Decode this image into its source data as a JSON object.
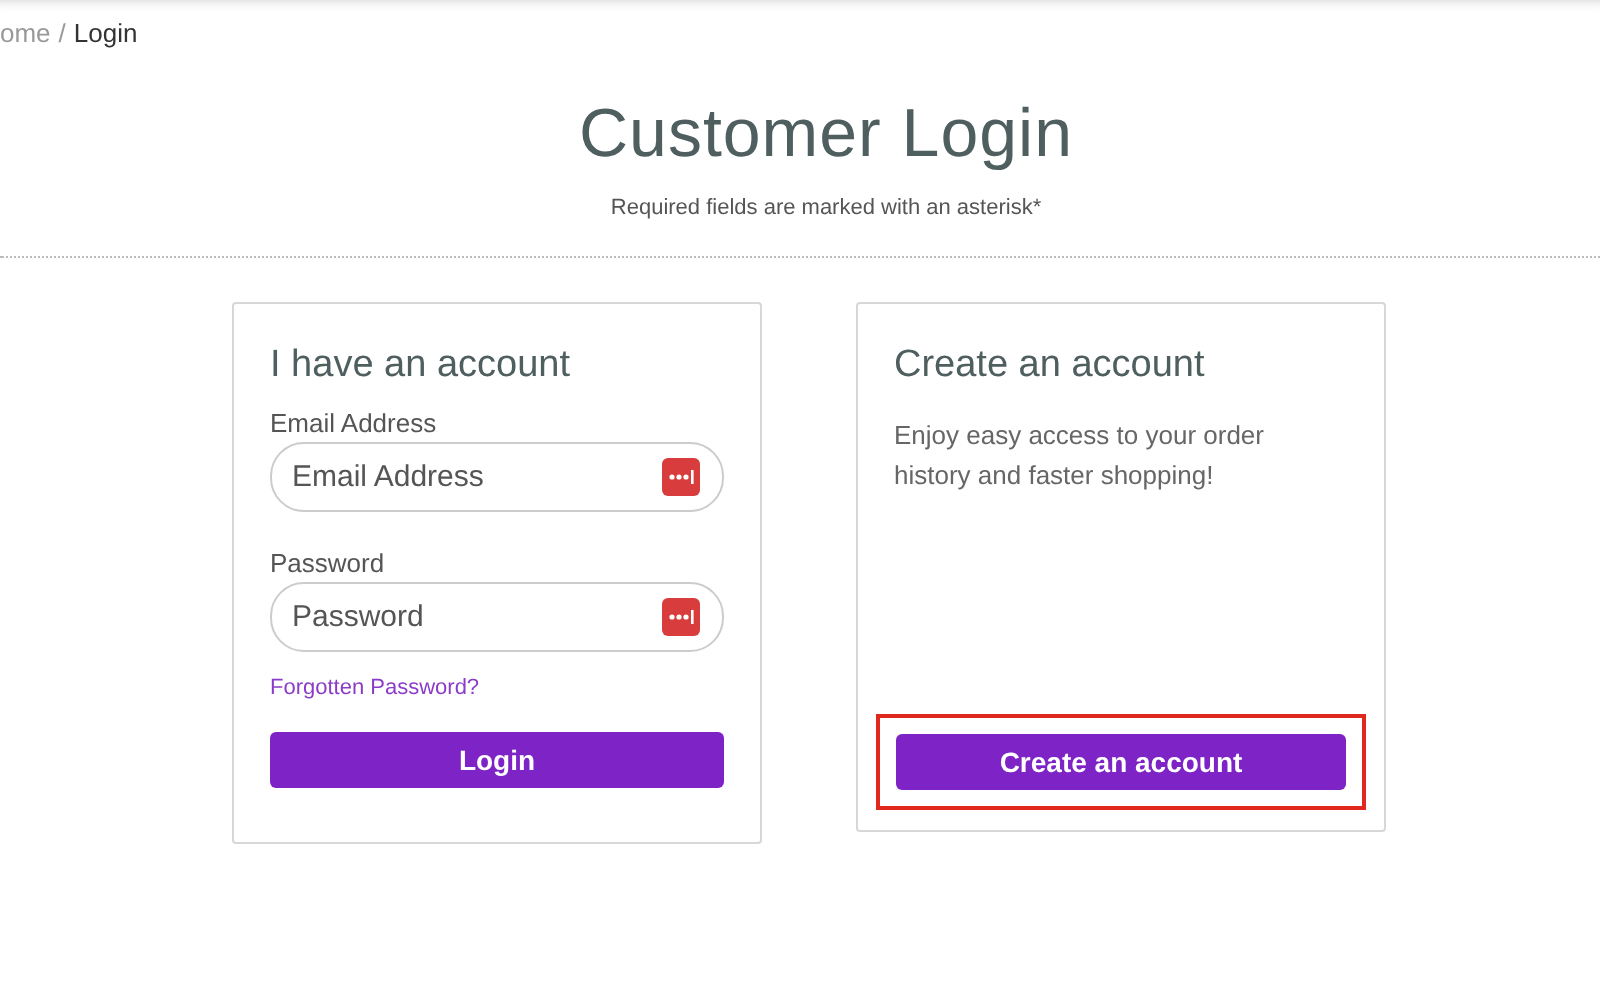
{
  "breadcrumb": {
    "items": [
      {
        "label": "ome",
        "selected": false
      },
      {
        "label": "Login",
        "selected": true
      }
    ],
    "separator": "/"
  },
  "title": "Customer Login",
  "subtitle": "Required fields are marked with an asterisk*",
  "login_panel": {
    "heading": "I have an account",
    "fields": [
      {
        "label": "Email Address",
        "placeholder": "Email Address"
      },
      {
        "label": "Password",
        "placeholder": "Password"
      }
    ],
    "forgot_link": "Forgotten Password?",
    "button": "Login"
  },
  "register_panel": {
    "heading": "Create an account",
    "text": "Enjoy easy access to your order history and faster shopping!",
    "button": "Create an account",
    "highlighted": true
  }
}
